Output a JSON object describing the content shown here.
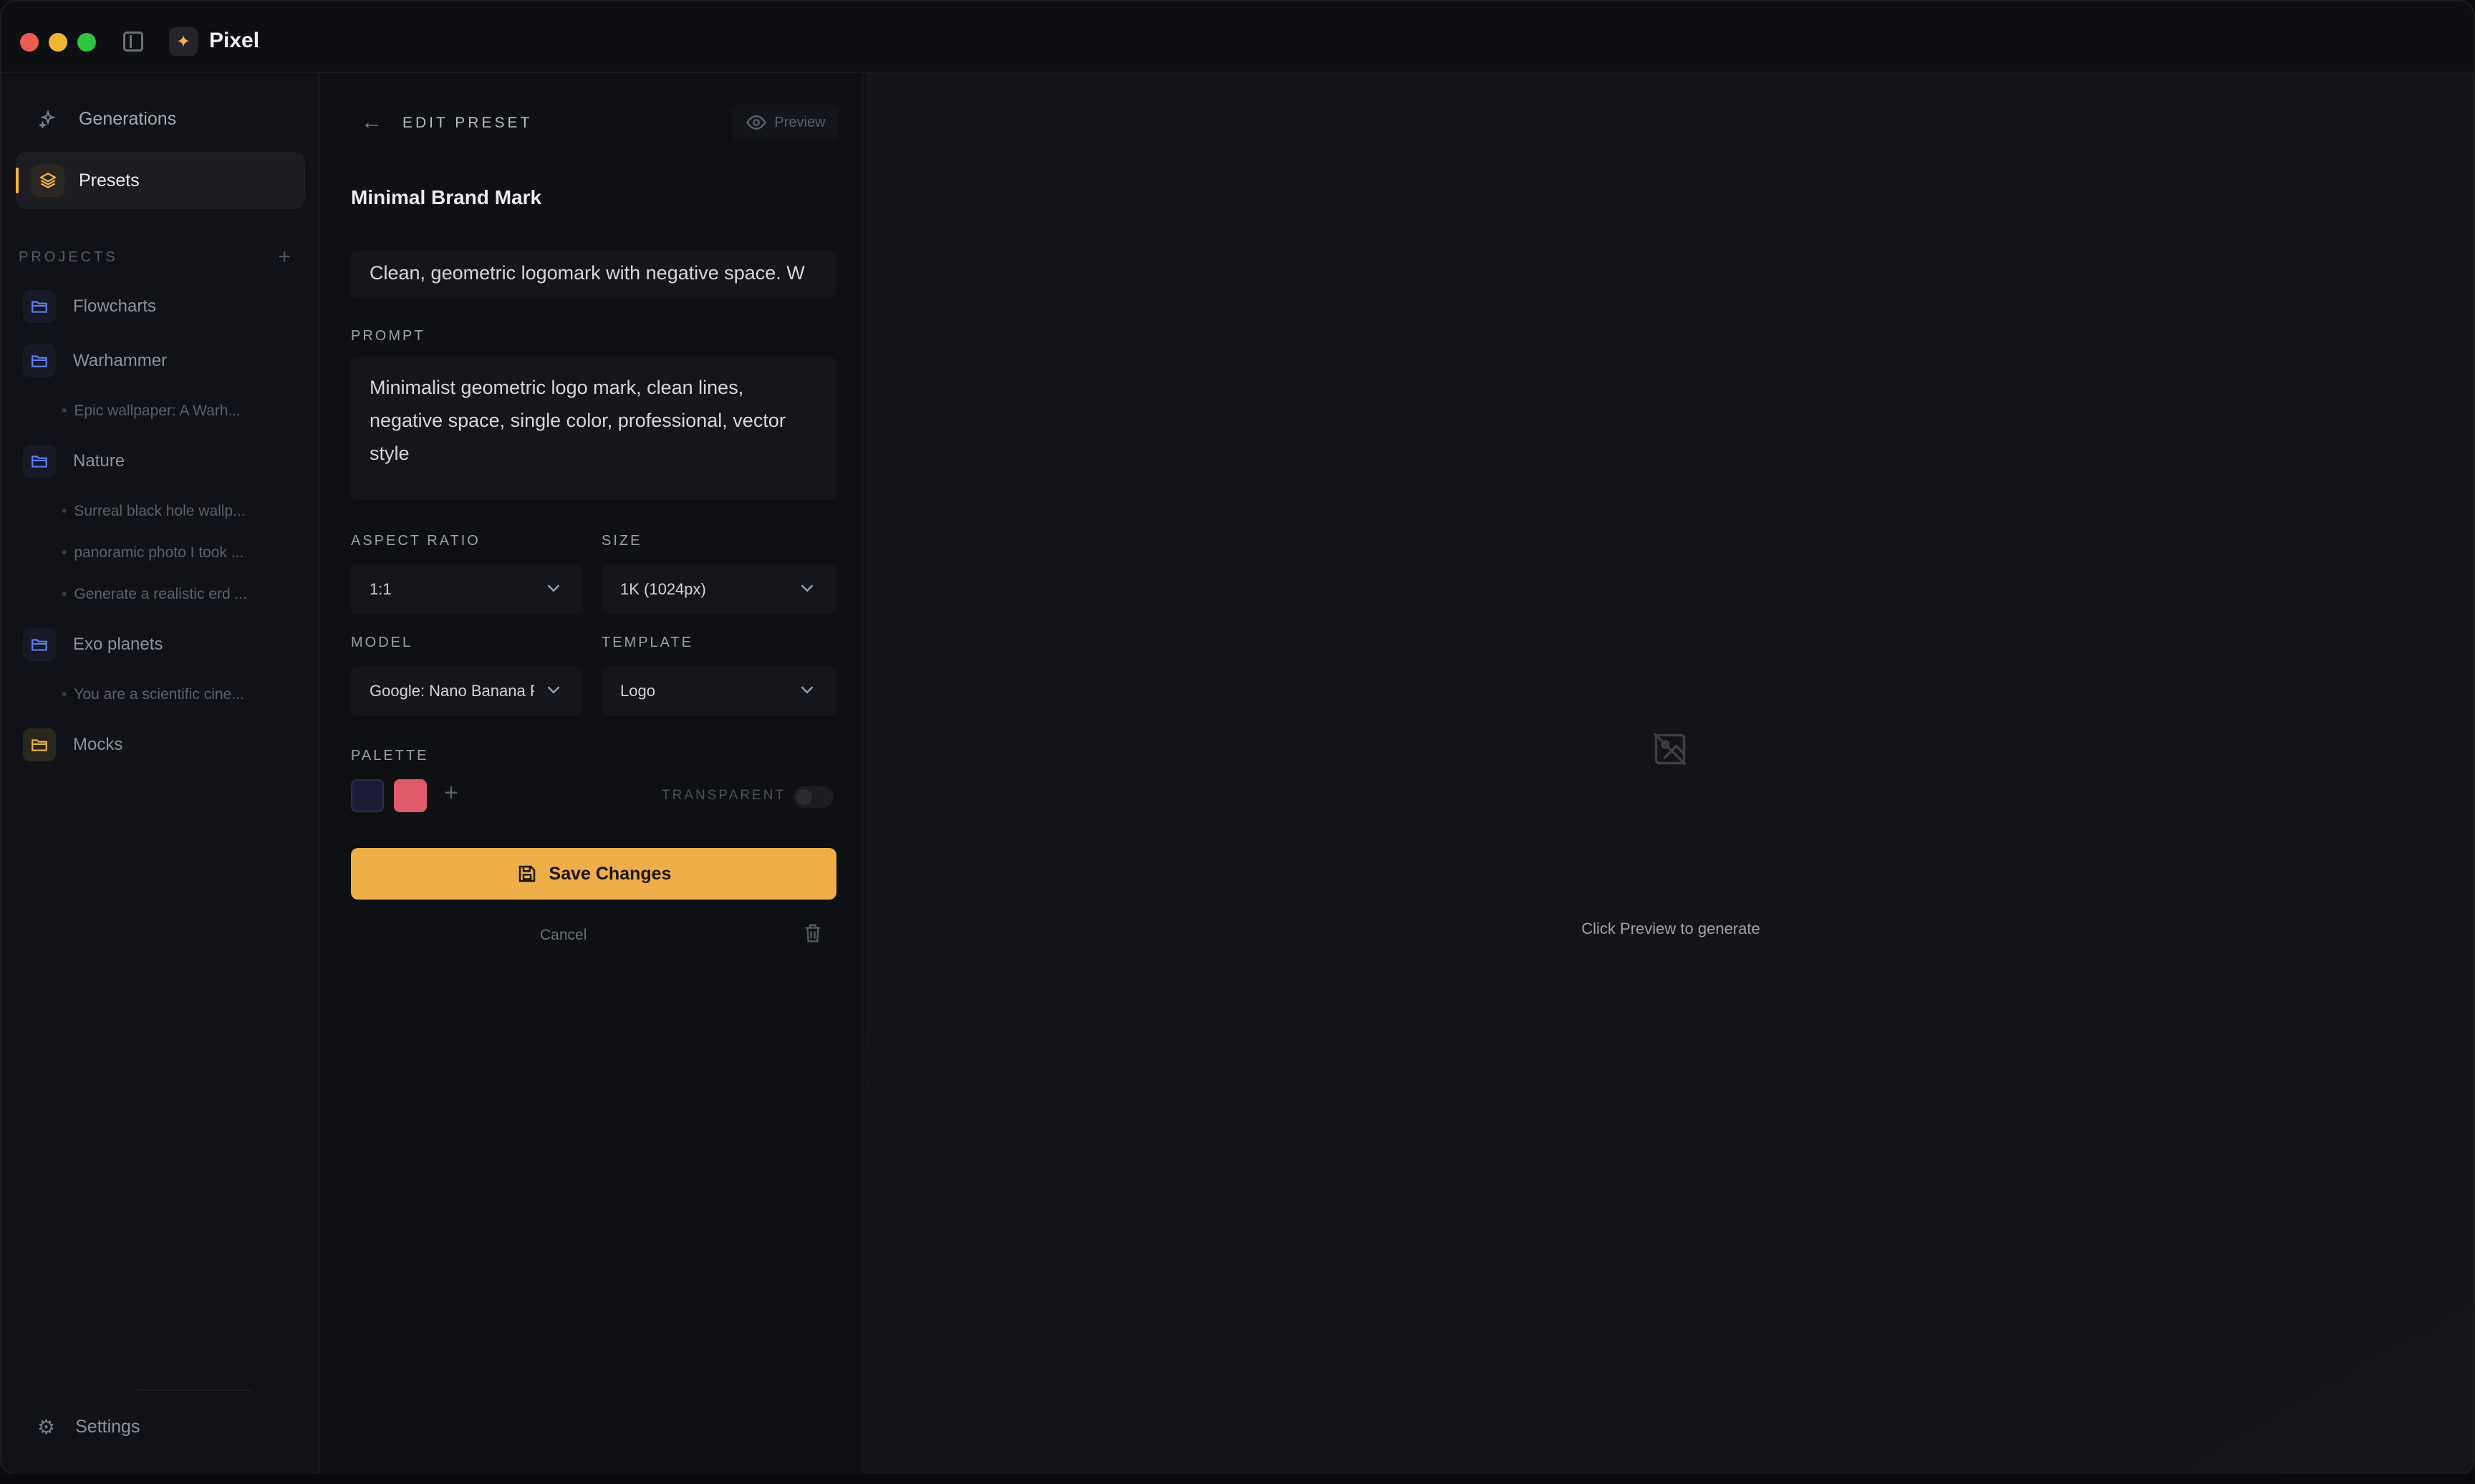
{
  "app": {
    "title": "Pixel",
    "logo_icon": "sparkle-icon",
    "accent": "#eeae49"
  },
  "sidebar": {
    "nav": [
      {
        "label": "Generations",
        "icon": "sparkles-icon"
      },
      {
        "label": "Presets",
        "icon": "layers-icon"
      }
    ],
    "projects_label": "PROJECTS",
    "projects": [
      {
        "label": "Flowcharts"
      },
      {
        "label": "Warhammer",
        "items": [
          "Epic wallpaper: A Warh..."
        ]
      },
      {
        "label": "Nature",
        "items": [
          "Surreal black hole wallp...",
          "panoramic photo I took ...",
          "Generate a realistic erd ..."
        ]
      },
      {
        "label": "Exo planets",
        "items": [
          "You are a scientific cine..."
        ]
      },
      {
        "label": "Mocks"
      }
    ],
    "settings_label": "Settings"
  },
  "editor": {
    "title": "EDIT PRESET",
    "preview_label": "Preview",
    "preset_name": "Minimal Brand Mark",
    "description": "Clean, geometric logomark with negative space. W",
    "prompt_label": "PROMPT",
    "prompt": "Minimalist geometric logo mark, clean lines, negative space, single color, professional, vector style",
    "aspect_ratio_label": "ASPECT RATIO",
    "aspect_ratio": "1:1",
    "size_label": "SIZE",
    "size": "1K (1024px)",
    "model_label": "MODEL",
    "model": "Google: Nano Banana P",
    "template_label": "TEMPLATE",
    "template": "Logo",
    "palette_label": "PALETTE",
    "palette_colors": [
      "#1a1d33",
      "#e05a6a"
    ],
    "transparent_label": "TRANSPARENT",
    "save_label": "Save Changes",
    "cancel_label": "Cancel"
  },
  "canvas": {
    "empty_text": "Click Preview to generate",
    "empty_icon": "image-off-icon"
  }
}
